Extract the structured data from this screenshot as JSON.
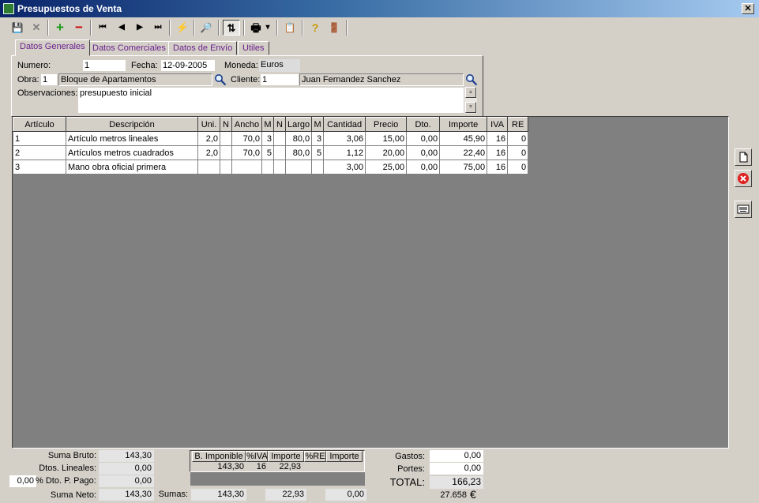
{
  "window": {
    "title": "Presupuestos de Venta",
    "close_label": "✕"
  },
  "toolbar": {
    "save": "💾",
    "cancel": "✕",
    "add": "+",
    "remove": "−",
    "first": "⏮",
    "prev": "◀",
    "next": "▶",
    "last": "⏭",
    "action": "⚡",
    "find": "🔎",
    "sort": "⇅",
    "print": "🖶",
    "print_menu": "▾",
    "copy": "📋",
    "help": "?",
    "exit": "🚪"
  },
  "tabs": [
    {
      "label": "Datos Generales"
    },
    {
      "label": "Datos Comerciales"
    },
    {
      "label": "Datos de Envío"
    },
    {
      "label": "Utiles"
    }
  ],
  "header": {
    "numero_label": "Numero:",
    "numero_value": "1",
    "fecha_label": "Fecha:",
    "fecha_value": "12-09-2005",
    "moneda_label": "Moneda:",
    "moneda_value": "Euros",
    "obra_label": "Obra:",
    "obra_code": "1",
    "obra_name": "Bloque de Apartamentos",
    "cliente_label": "Cliente:",
    "cliente_code": "1",
    "cliente_name": "Juan Fernandez Sanchez",
    "observaciones_label": "Observaciones:",
    "observaciones_value": "presupuesto inicial"
  },
  "grid": {
    "columns": [
      "Artículo",
      "Descripción",
      "Uni.",
      "N",
      "Ancho",
      "M",
      "N",
      "Largo",
      "M",
      "Cantidad",
      "Precio",
      "Dto.",
      "Importe",
      "IVA",
      "RE"
    ],
    "rows": [
      [
        "1",
        "Artículo metros lineales",
        "2,0",
        "",
        "70,0",
        "3",
        "",
        "80,0",
        "3",
        "3,06",
        "15,00",
        "0,00",
        "45,90",
        "16",
        "0"
      ],
      [
        "2",
        "Artículos metros cuadrados",
        "2,0",
        "",
        "70,0",
        "5",
        "",
        "80,0",
        "5",
        "1,12",
        "20,00",
        "0,00",
        "22,40",
        "16",
        "0"
      ],
      [
        "3",
        "Mano obra oficial primera",
        "",
        "",
        "",
        "",
        "",
        "",
        "",
        "3,00",
        "25,00",
        "0,00",
        "75,00",
        "16",
        "0"
      ]
    ]
  },
  "side_icons": {
    "new": "new-document",
    "delete": "delete",
    "keyboard": "keyboard"
  },
  "footer": {
    "suma_bruto_label": "Suma Bruto:",
    "suma_bruto": "143,30",
    "dtos_lineales_label": "Dtos. Lineales:",
    "dtos_lineales": "0,00",
    "dto_pago_pct": "0,00",
    "dto_pago_label": "% Dto. P. Pago:",
    "dto_pago": "0,00",
    "suma_neto_label": "Suma Neto:",
    "suma_neto": "143,30",
    "tax_headers": [
      "B. Imponible",
      "%IVA",
      "Importe",
      "%RE",
      "Importe"
    ],
    "tax_row": [
      "143,30",
      "16",
      "22,93",
      "",
      ""
    ],
    "sumas_label": "Sumas:",
    "sumas_base": "143,30",
    "sumas_iva": "22,93",
    "sumas_re": "0,00",
    "gastos_label": "Gastos:",
    "gastos": "0,00",
    "portes_label": "Portes:",
    "portes": "0,00",
    "total_label": "TOTAL:",
    "total": "166,23",
    "total_other_currency": "27.658",
    "currency_symbol": "€"
  }
}
